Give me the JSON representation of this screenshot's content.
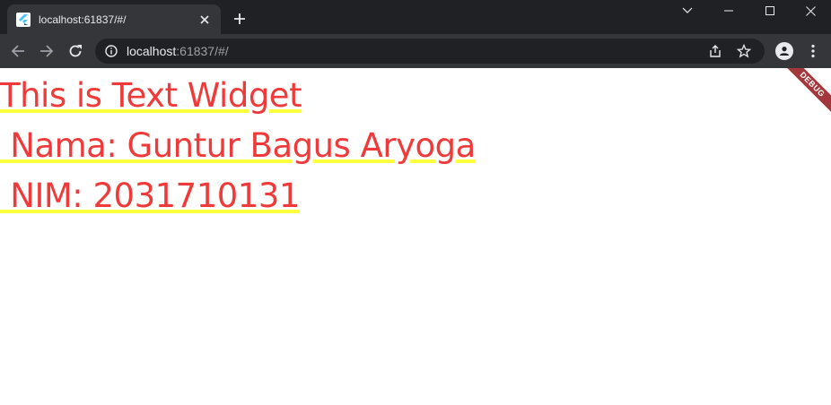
{
  "browser": {
    "tab": {
      "title": "localhost:61837/#/",
      "favicon": "flutter-logo-icon",
      "close_icon": "close-icon"
    },
    "new_tab_icon": "plus-icon",
    "window_controls": [
      "chevron-down-icon",
      "minimize-icon",
      "maximize-icon",
      "close-icon"
    ],
    "toolbar": {
      "back_icon": "arrow-left-icon",
      "forward_icon": "arrow-right-icon",
      "reload_icon": "reload-icon",
      "site_info_icon": "info-icon",
      "url_host": "localhost",
      "url_rest": ":61837/#/",
      "share_icon": "share-icon",
      "bookmark_icon": "star-icon",
      "profile_icon": "person-icon",
      "menu_icon": "more-vert-icon"
    },
    "colors": {
      "tabstrip": "#202124",
      "toolbar": "#35363a",
      "omnibox": "#202124"
    }
  },
  "page": {
    "text_widget": "This is Text Widget\n Nama: Guntur Bagus Aryoga\n NIM: 2031710131",
    "debug_banner": "DEBUG",
    "colors": {
      "text": "#f03a3a",
      "underline": "#ffff3d",
      "banner": "#a2383c"
    }
  }
}
